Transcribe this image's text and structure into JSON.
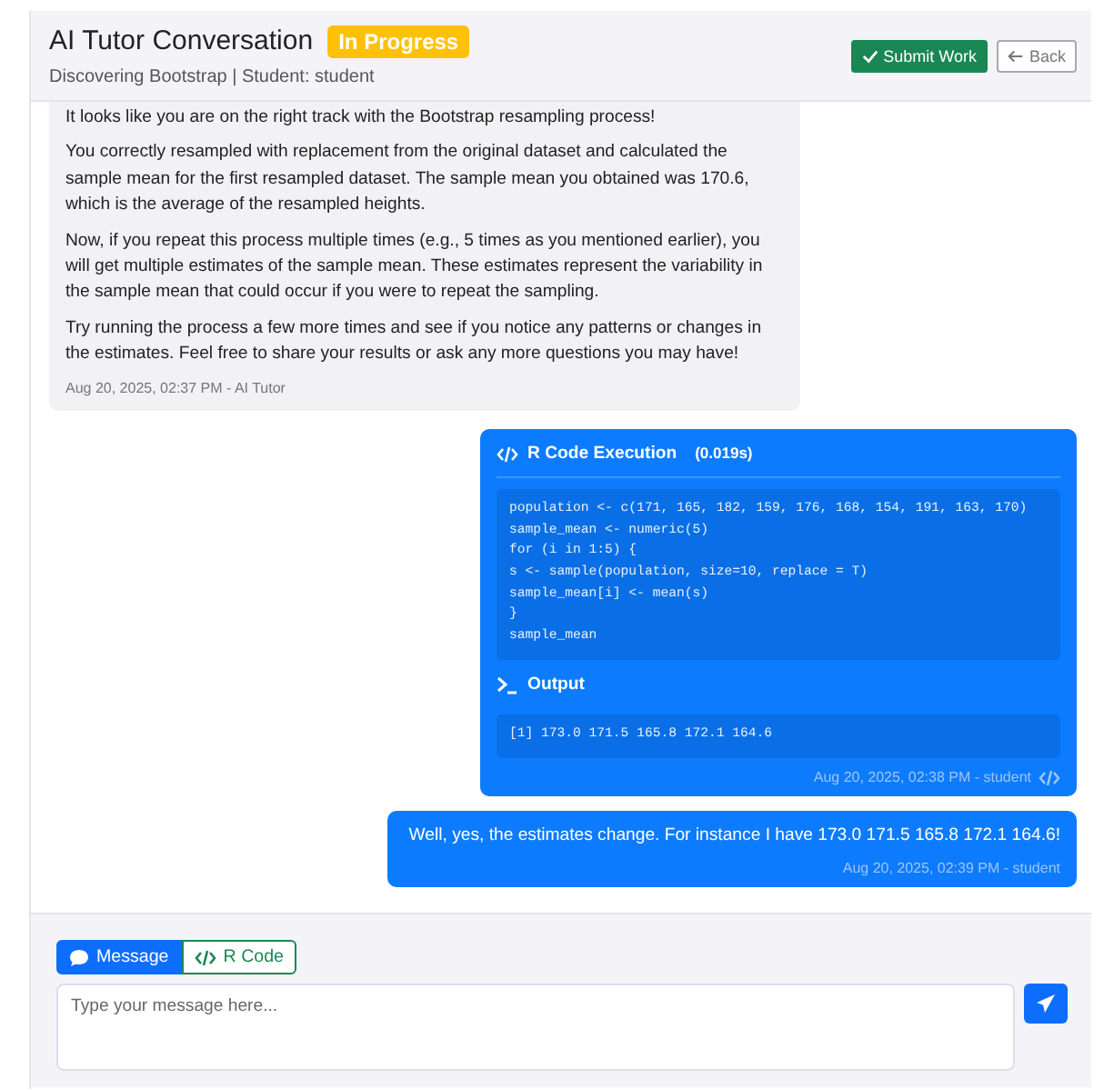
{
  "header": {
    "title": "AI Tutor Conversation",
    "status": "In Progress",
    "subtitle": "Discovering Bootstrap | Student: student",
    "buttons": [
      {
        "kind": "submit",
        "label": "Submit Work"
      },
      {
        "kind": "back",
        "label": "Back"
      }
    ]
  },
  "messages": [
    {
      "kind": "tutor",
      "paragraphs": [
        "It looks like you are on the right track with the Bootstrap resampling process!",
        "You correctly resampled with replacement from the original dataset and calculated the sample mean for the first resampled dataset. The sample mean you obtained was 170.6, which is the average of the resampled heights.",
        "Now, if you repeat this process multiple times (e.g., 5 times as you mentioned earlier), you will get multiple estimates of the sample mean. These estimates represent the variability in the sample mean that could occur if you were to repeat the sampling.",
        "Try running the process a few more times and see if you notice any patterns or changes in the estimates. Feel free to share your results or ask any more questions you may have!"
      ],
      "meta": "Aug 20, 2025, 02:37 PM - AI Tutor"
    },
    {
      "kind": "code",
      "title": "R Code Execution",
      "duration": "(0.019s)",
      "code": [
        "population <- c(171, 165, 182, 159, 176, 168, 154, 191, 163, 170)",
        "sample_mean <- numeric(5)",
        "for (i in 1:5) {",
        "s <- sample(population, size=10, replace = T)",
        "sample_mean[i] <- mean(s)",
        "}",
        "sample_mean"
      ],
      "output_label": "Output",
      "output": "[1] 173.0 171.5 165.8 172.1 164.6",
      "meta": "Aug 20, 2025, 02:38 PM - student"
    },
    {
      "kind": "student",
      "paragraphs": [
        "Well, yes, the estimates change. For instance I have 173.0 171.5 165.8 172.1 164.6!"
      ],
      "meta": "Aug 20, 2025, 02:39 PM - student"
    }
  ],
  "composer": {
    "modes": [
      {
        "kind": "message",
        "label": "Message",
        "selected": true
      },
      {
        "kind": "code",
        "label": "R Code",
        "selected": false
      }
    ],
    "placeholder": "Type your message here..."
  }
}
